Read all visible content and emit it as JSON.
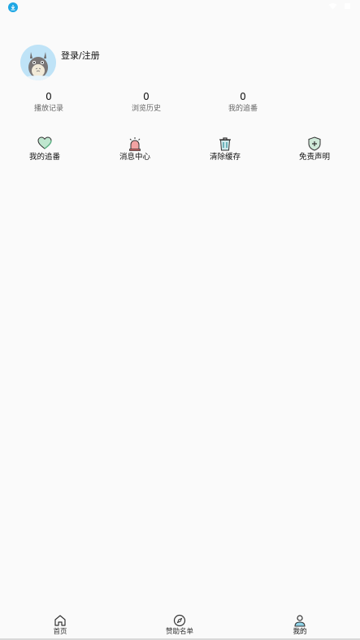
{
  "profile": {
    "login_label": "登录/注册"
  },
  "stats": [
    {
      "value": "0",
      "label": "播放记录"
    },
    {
      "value": "0",
      "label": "浏览历史"
    },
    {
      "value": "0",
      "label": "我的追番"
    }
  ],
  "actions": [
    {
      "label": "我的追番",
      "icon": "heart-icon"
    },
    {
      "label": "消息中心",
      "icon": "alarm-bell-icon"
    },
    {
      "label": "清除缓存",
      "icon": "trash-icon"
    },
    {
      "label": "免责声明",
      "icon": "shield-plus-icon"
    }
  ],
  "tabs": [
    {
      "label": "首页",
      "icon": "home-icon"
    },
    {
      "label": "赞助名单",
      "icon": "compass-icon"
    },
    {
      "label": "我的",
      "icon": "user-icon",
      "active": true
    }
  ],
  "colors": {
    "background": "#fafafa",
    "heart": "#7fc9a2",
    "alarm": "#e46a6a",
    "trash": "#2f8f9a",
    "shield": "#6fb38e",
    "status_download": "#1ea7e4"
  }
}
